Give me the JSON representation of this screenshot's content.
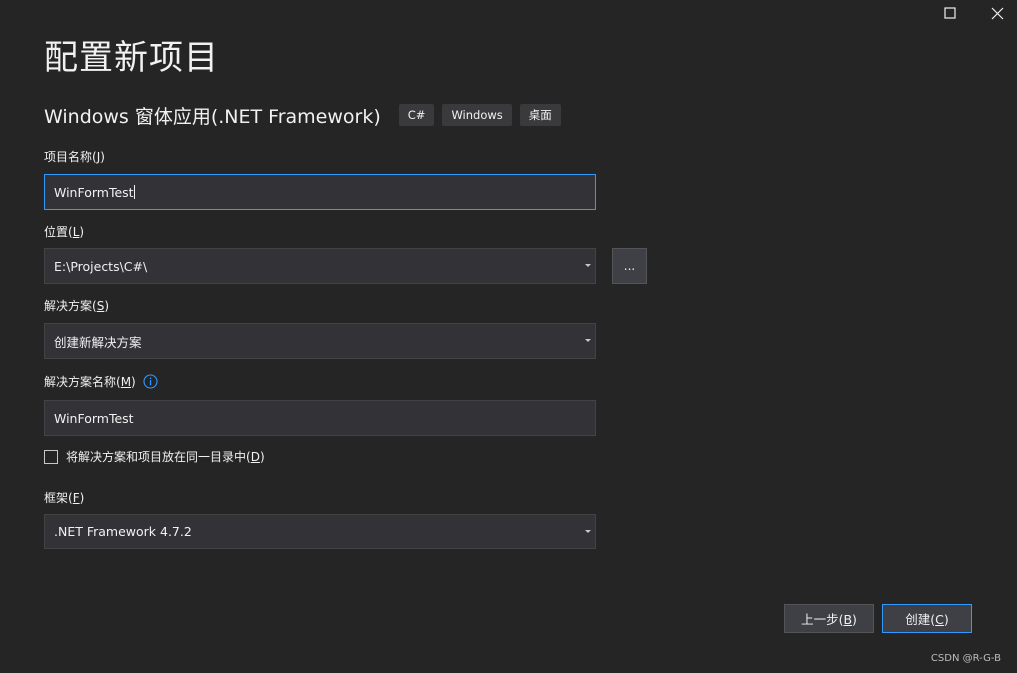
{
  "window": {
    "maximize_icon": "maximize-icon",
    "close_icon": "close-icon"
  },
  "header": {
    "title": "配置新项目",
    "subtitle": "Windows 窗体应用(.NET Framework)",
    "tags": [
      "C#",
      "Windows",
      "桌面"
    ]
  },
  "form": {
    "project_name": {
      "label": "项目名称(",
      "mnemonic": "J",
      "label_end": ")",
      "value": "WinFormTest"
    },
    "location": {
      "label": "位置(",
      "mnemonic": "L",
      "label_end": ")",
      "value": "E:\\Projects\\C#\\",
      "browse_label": "..."
    },
    "solution": {
      "label": "解决方案(",
      "mnemonic": "S",
      "label_end": ")",
      "value": "创建新解决方案"
    },
    "solution_name": {
      "label": "解决方案名称(",
      "mnemonic": "M",
      "label_end": ")",
      "value": "WinFormTest",
      "info_icon": "info-icon"
    },
    "same_directory": {
      "label": "将解决方案和项目放在同一目录中(",
      "mnemonic": "D",
      "label_end": ")",
      "checked": false
    },
    "framework": {
      "label": "框架(",
      "mnemonic": "F",
      "label_end": ")",
      "value": ".NET Framework 4.7.2"
    }
  },
  "footer": {
    "back_label": "上一步(",
    "back_mnemonic": "B",
    "back_end": ")",
    "create_label": "创建(",
    "create_mnemonic": "C",
    "create_end": ")",
    "watermark": "CSDN @R-G-B"
  },
  "colors": {
    "background": "#252526",
    "field_background": "#333337",
    "accent": "#3399ff",
    "text": "#f1f1f1"
  }
}
